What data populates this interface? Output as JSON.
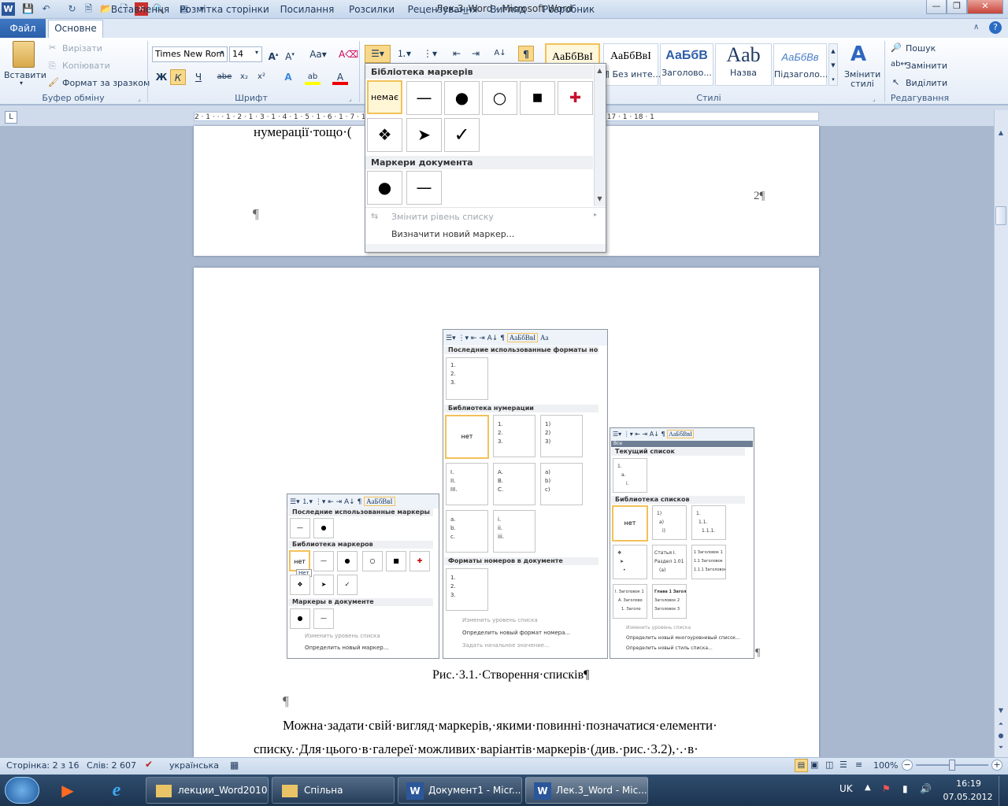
{
  "window": {
    "title": "Лек.3_Word - Microsoft Word",
    "app_icon": "W"
  },
  "quick_access": {
    "icons": [
      "save-icon",
      "undo-icon",
      "redo-icon",
      "print-preview-icon",
      "open-icon",
      "new-icon",
      "close-red-icon",
      "zoom-icon",
      "form-icon"
    ]
  },
  "tabs": [
    "Файл",
    "Основне",
    "Вставлення",
    "Розмітка сторінки",
    "Посилання",
    "Розсилки",
    "Рецензування",
    "Вигляд",
    "Розробник"
  ],
  "clipboard": {
    "paste": "Вставити",
    "cut": "Вирізати",
    "copy": "Копіювати",
    "format": "Формат за зразком",
    "label": "Буфер обміну"
  },
  "font": {
    "name": "Times New Rom",
    "size": "14",
    "label": "Шрифт"
  },
  "styles": {
    "label": "Стилі",
    "change": "Змінити стилі",
    "tiles": [
      {
        "preview": "АаБбВвІ",
        "name": ""
      },
      {
        "preview": "АаБбВвІ",
        "name": "¶ Без инте..."
      },
      {
        "preview": "АаБбВ",
        "name": "Заголово..."
      },
      {
        "preview": "Aab",
        "name": "Назва"
      },
      {
        "preview": "АаБбВв",
        "name": "Підзаголо..."
      }
    ]
  },
  "editing": {
    "find": "Пошук",
    "replace": "Замінити",
    "select": "Виділити",
    "label": "Редагування"
  },
  "ruler": {
    "marks": "2 · 1 · · · 1 · 2 · 1 · 3 · 1 · 4 · 1 · 5 · 1 · 6 · 1 · 7 · 1 · 8 · 1 · 9 · 1 · 10 · 1 · 11 · 1 · 12 · 1 · 13 · 1 · 14 · 1 · 15 · 1 · 16 · 1 · 17 · 1 · 18 · 1"
  },
  "dropdown": {
    "library_header": "Бібліотека маркерів",
    "none_label": "немає",
    "bullets": [
      "—",
      "●",
      "○",
      "■",
      "✚",
      "❖",
      "➤",
      "✓"
    ],
    "document_header": "Маркери документа",
    "doc_bullets": [
      "●",
      "—"
    ],
    "change_level": "Змінити рівень списку",
    "define_new": "Визначити новий маркер..."
  },
  "document": {
    "top_line": "нумерації·тощо·(",
    "page_number": "2¶",
    "pilcrow": "¶",
    "caption": "Рис.·3.1.·Створення·списків¶",
    "para_mark": "¶",
    "line1": "Можна·задати·свій·вигляд·маркерів,·якими·повинні·позначатися·елементи·",
    "line2": "списку.·Для·цього·в·галереї·можливих·варіантів·маркерів·(див.·рис.·3.2),·.·в·",
    "figure_pilcrow": "¶"
  },
  "figure": {
    "left": {
      "recent_header": "Последние использованные маркеры",
      "library_header": "Библиотека маркеров",
      "none": "нет",
      "tooltip": "Нет",
      "doc_header": "Маркеры в документе",
      "change_level": "Изменить уровень списка",
      "define_new": "Определить новый маркер...",
      "preview": "АаБбВвІ"
    },
    "middle": {
      "recent_header": "Последние использованные форматы номеров",
      "library_header": "Библиотека нумерации",
      "none": "нет",
      "doc_header": "Форматы номеров в документе",
      "change_level": "Изменить уровень списка",
      "define_new": "Определить новый формат номера...",
      "set_value": "Задать начальное значение...",
      "preview": "АаБбВвІ",
      "preview2": "Аа",
      "recent": [
        "1.",
        "2.",
        "3."
      ],
      "lib": [
        [
          "1.",
          "2.",
          "3."
        ],
        [
          "1)",
          "2)",
          "3)"
        ],
        [
          "I.",
          "II.",
          "III."
        ],
        [
          "A.",
          "B.",
          "C."
        ],
        [
          "a)",
          "b)",
          "c)"
        ],
        [
          "a.",
          "b.",
          "c."
        ],
        [
          "i.",
          "ii.",
          "iii."
        ]
      ],
      "doc": [
        "1.",
        "2.",
        "3."
      ]
    },
    "right": {
      "all": "Все",
      "current_header": "Текущий список",
      "library_header": "Библиотека списков",
      "none": "нет",
      "change_level": "Изменить уровень списка",
      "define_multi": "Определить новый многоуровневый список...",
      "define_style": "Определить новый стиль списка...",
      "preview": "АаБбВвІ",
      "current": [
        "1.",
        "a.",
        "i."
      ],
      "cells": [
        [
          "1)",
          "a)",
          "i)"
        ],
        [
          "1.",
          "1.1.",
          "1.1.1."
        ],
        [
          "❖",
          "➤",
          "•"
        ],
        [
          "Статья I.",
          "Раздел 1.01",
          "(a)"
        ],
        [
          "1 Заголовок 1",
          "1.1 Заголовок",
          "1.1.1 Заголовок"
        ],
        [
          "I. Заголовок 1",
          "A. Заголово",
          "1. Заголо"
        ],
        [
          "Глава 1 Загол",
          "Заголовок 2",
          "Заголовок 3"
        ]
      ]
    }
  },
  "statusbar": {
    "page": "Сторінка: 2 з 16",
    "words": "Слів: 2 607",
    "lang": "українська",
    "zoom": "100%"
  },
  "taskbar": {
    "items": [
      "лекции_Word2010",
      "Спільна",
      "Документ1 - Micr...",
      "Лек.3_Word - Mic..."
    ],
    "lang": "UK",
    "time": "16:19",
    "date": "07.05.2012"
  }
}
